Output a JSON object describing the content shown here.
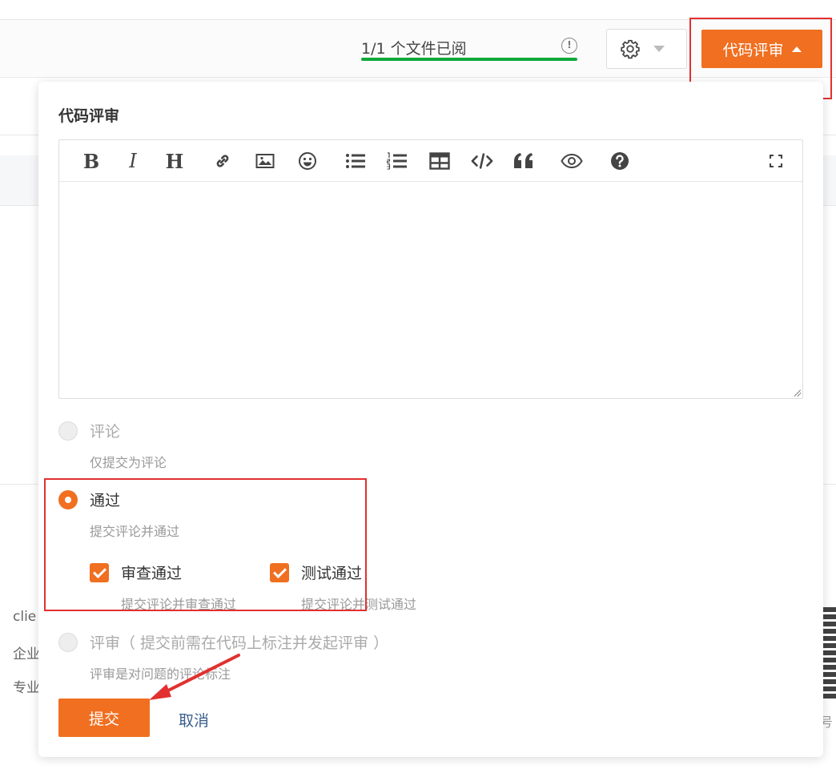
{
  "header": {
    "files_read_label": "1/1 个文件已阅",
    "files_read_progress": 1.0,
    "info_icon": "info-circle-icon",
    "settings_icon": "gear-icon",
    "review_button_label": "代码评审"
  },
  "background": {
    "footer_items": [
      "clie",
      "企业",
      "专业"
    ],
    "qr_mark": "号"
  },
  "popup": {
    "title": "代码评审",
    "toolbar": [
      {
        "name": "bold-icon",
        "text": "B"
      },
      {
        "name": "italic-icon",
        "text": "I"
      },
      {
        "name": "heading-icon",
        "text": "H"
      },
      {
        "name": "link-icon"
      },
      {
        "name": "image-icon"
      },
      {
        "name": "emoji-icon"
      },
      {
        "name": "bullet-list-icon"
      },
      {
        "name": "numbered-list-icon"
      },
      {
        "name": "table-icon"
      },
      {
        "name": "code-icon"
      },
      {
        "name": "quote-icon"
      },
      {
        "name": "preview-eye-icon"
      },
      {
        "name": "help-icon"
      },
      {
        "name": "fullscreen-icon"
      }
    ],
    "editor_value": "",
    "options": {
      "comment": {
        "label": "评论",
        "desc": "仅提交为评论",
        "selected": false,
        "disabled": true
      },
      "approve": {
        "label": "通过",
        "desc": "提交评论并通过",
        "selected": true,
        "disabled": false
      },
      "review_pass": {
        "label": "审查通过",
        "desc": "提交评论并审查通过",
        "checked": true
      },
      "test_pass": {
        "label": "测试通过",
        "desc": "提交评论并测试通过",
        "checked": true
      },
      "review": {
        "label": "评审（ 提交前需在代码上标注并发起评审 ）",
        "desc": "评审是对问题的评论标注",
        "selected": false,
        "disabled": true
      }
    },
    "submit_label": "提交",
    "cancel_label": "取消"
  },
  "colors": {
    "accent": "#f06f20",
    "progress": "#0fa83a",
    "highlight": "#e23030",
    "link": "#3a5e8c"
  }
}
